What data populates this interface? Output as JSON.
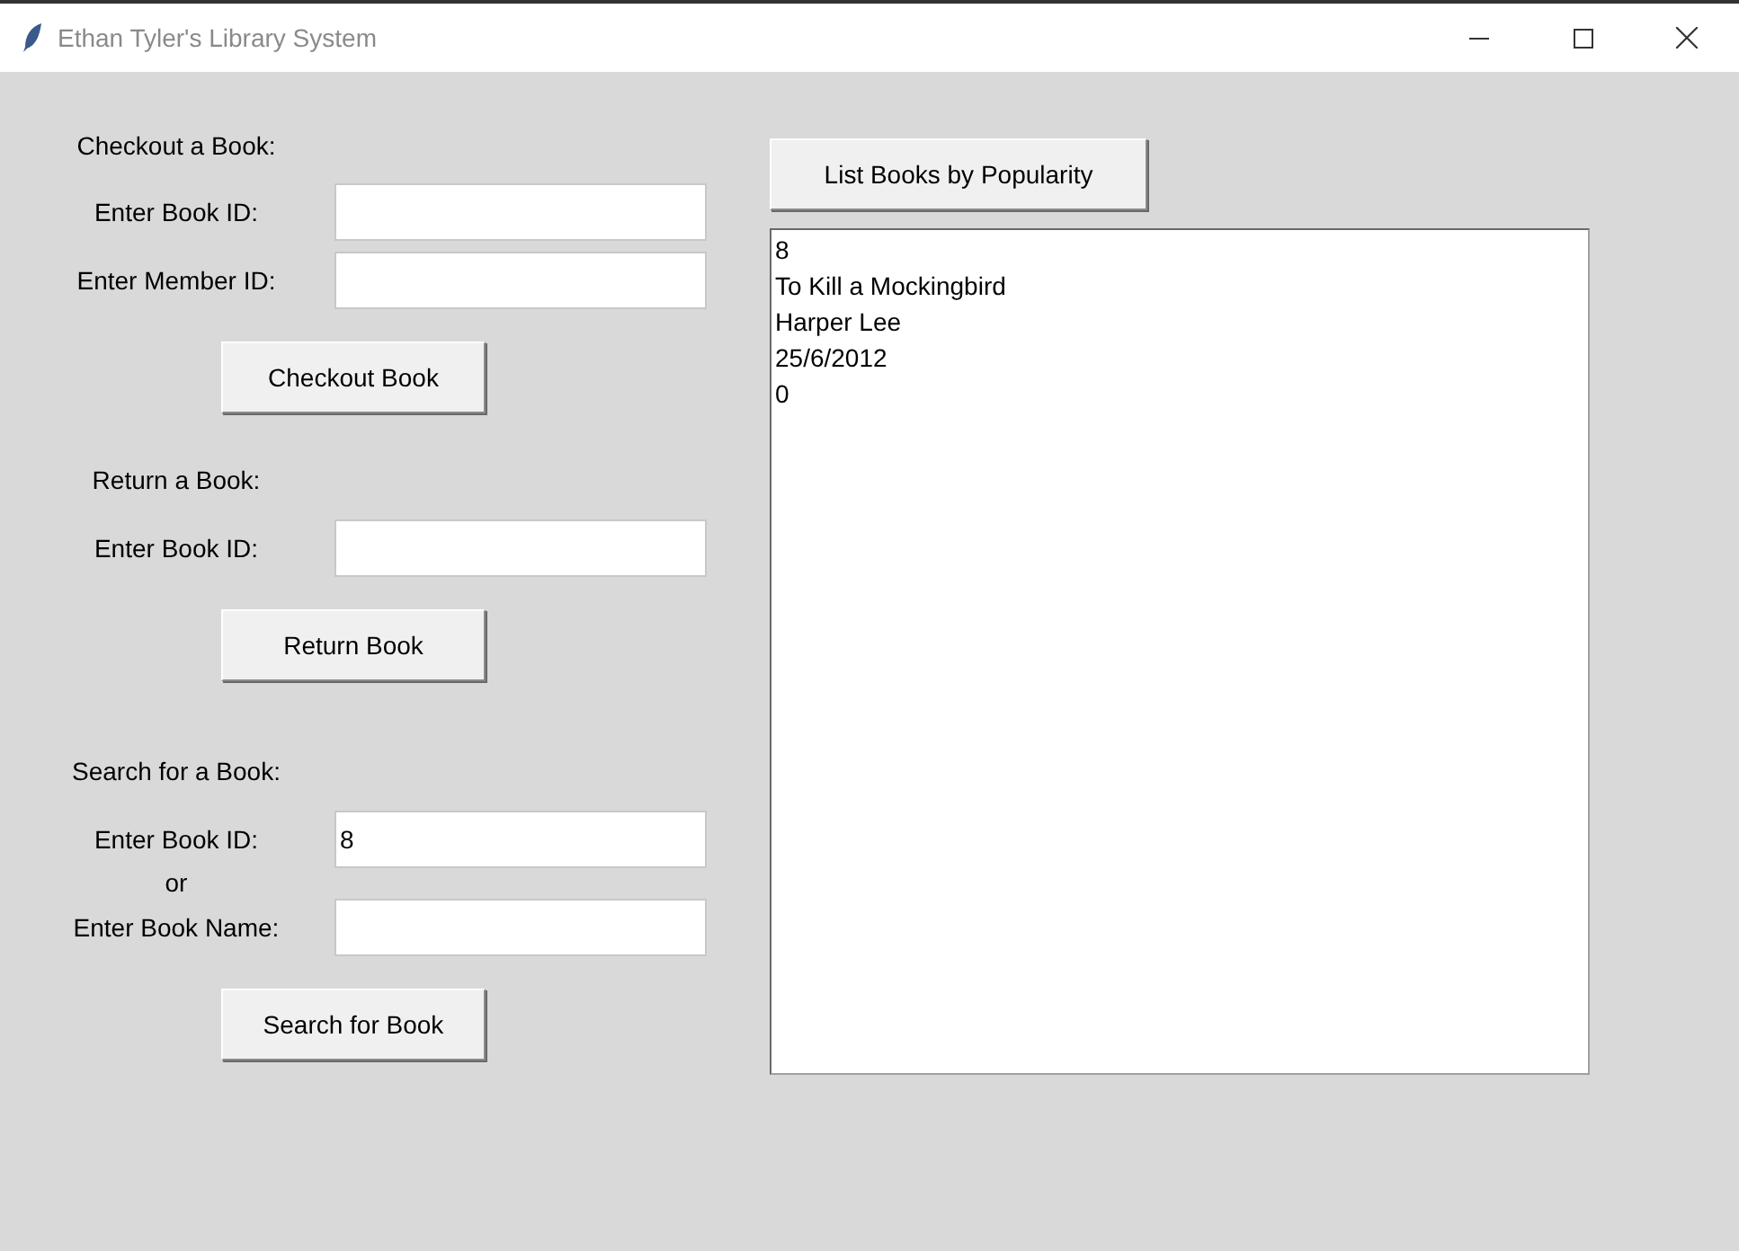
{
  "window": {
    "title": "Ethan Tyler's Library System"
  },
  "sections": [
    {
      "heading": "Checkout a Book:",
      "rows": [
        {
          "kind": "field",
          "label": "Enter Book ID:"
        },
        {
          "kind": "field",
          "label": "Enter Member ID:"
        }
      ],
      "button": "Checkout Book"
    },
    {
      "heading": "Return a Book:",
      "rows": [
        {
          "kind": "field",
          "label": "Enter Book ID:"
        }
      ],
      "button": "Return Book"
    },
    {
      "heading": "Search for a Book:",
      "rows": [
        {
          "kind": "field",
          "label": "Enter Book ID:",
          "value": "8"
        },
        {
          "kind": "separator",
          "label": "or"
        },
        {
          "kind": "field",
          "label": "Enter Book Name:"
        }
      ],
      "button": "Search for Book"
    }
  ],
  "popularity_button": "List Books by Popularity",
  "output_lines": [
    "8",
    "To Kill a Mockingbird",
    "Harper Lee",
    "25/6/2012",
    "0"
  ]
}
